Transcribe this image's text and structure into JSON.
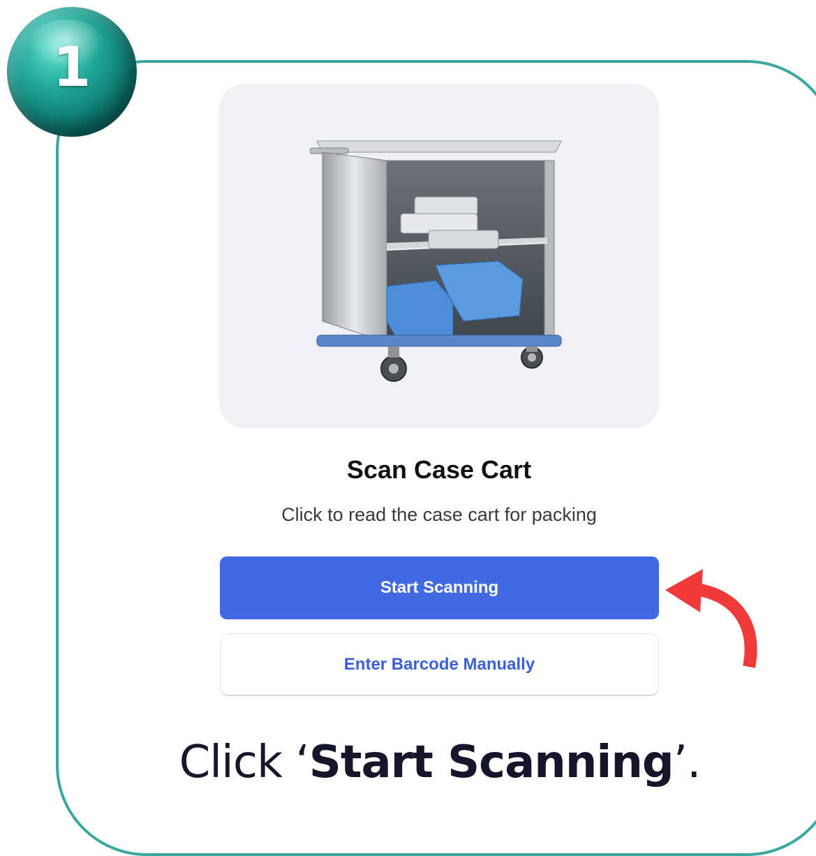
{
  "step": {
    "number": "1"
  },
  "card": {
    "title": "Scan Case Cart",
    "subtitle": "Click to read the case cart for packing"
  },
  "buttons": {
    "primary_label": "Start Scanning",
    "secondary_label": "Enter Barcode Manually"
  },
  "caption": {
    "prefix": "Click ‘",
    "emphasis": "Start Scanning",
    "suffix": "’."
  },
  "icons": {
    "badge": "step-number-badge",
    "image": "case-cart-image",
    "pointer": "curved-arrow-icon"
  },
  "colors": {
    "frame": "#3aa8a0",
    "primary_button": "#4169e1",
    "secondary_text": "#3b5fd9",
    "arrow": "#f03a3a",
    "image_background": "#f1f1f5"
  }
}
